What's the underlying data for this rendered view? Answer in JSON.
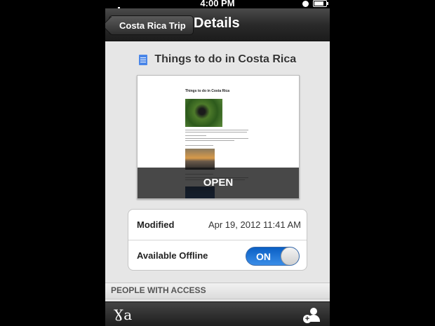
{
  "statusbar": {
    "time": "4:00 PM"
  },
  "navbar": {
    "back_label": "Costa Rica Trip",
    "title": "Details"
  },
  "document": {
    "title": "Things to do in Costa Rica",
    "icon": "doc-icon",
    "preview_title": "Things to do in Costa Rica",
    "open_label": "OPEN"
  },
  "details": {
    "modified_label": "Modified",
    "modified_value": "Apr 19, 2012 11:41 AM",
    "offline_label": "Available Offline",
    "offline_toggle": "ON"
  },
  "access": {
    "section_title": "PEOPLE WITH ACCESS"
  },
  "toolbar": {
    "left_icon": "translate-icon",
    "right_icon": "add-person-icon"
  },
  "colors": {
    "accent": "#2a7ad6",
    "doc_icon": "#4a86e8"
  }
}
